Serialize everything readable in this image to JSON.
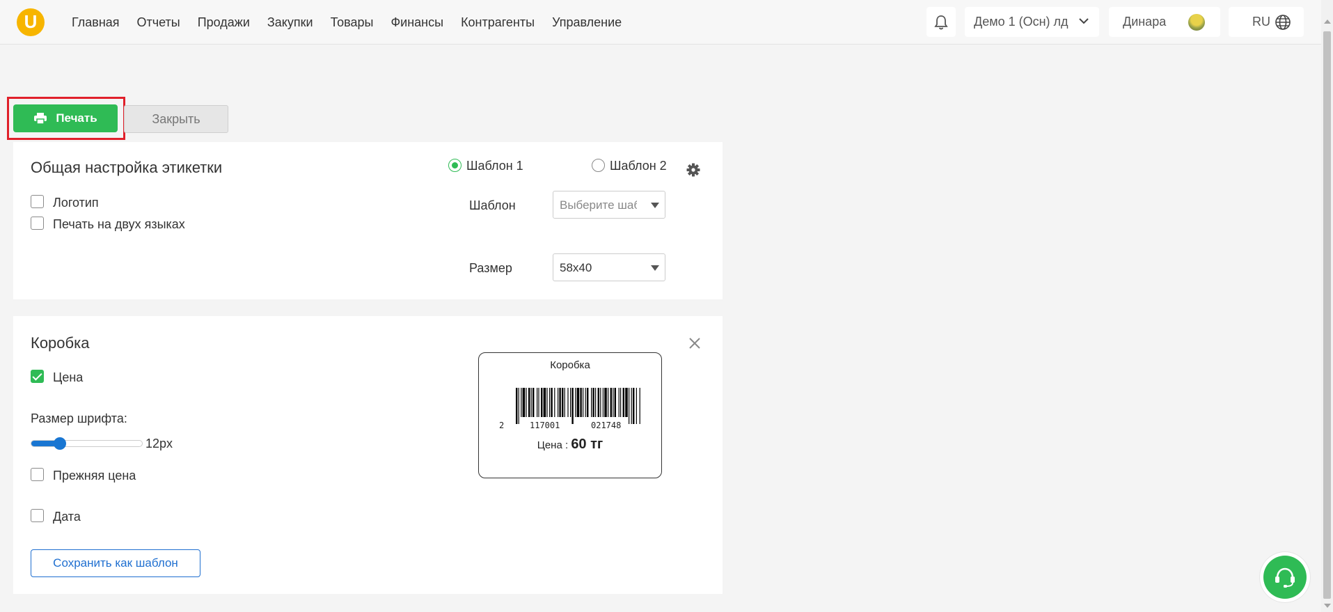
{
  "header": {
    "logo_letter": "U",
    "nav": [
      "Главная",
      "Отчеты",
      "Продажи",
      "Закупки",
      "Товары",
      "Финансы",
      "Контрагенты",
      "Управление"
    ],
    "company": "Демо 1 (Осн) лд",
    "user": "Динара",
    "language": "RU"
  },
  "actions": {
    "print_label": "Печать",
    "close_label": "Закрыть"
  },
  "general": {
    "title": "Общая настройка этикетки",
    "logo_label": "Логотип",
    "logo_checked": false,
    "bilingual_label": "Печать на двух языках",
    "bilingual_checked": false,
    "template1_label": "Шаблон 1",
    "template1_selected": true,
    "template2_label": "Шаблон 2",
    "template2_selected": false,
    "template_field_label": "Шаблон",
    "template_placeholder": "Выберите шабл",
    "size_field_label": "Размер",
    "size_value": "58x40"
  },
  "box": {
    "title": "Коробка",
    "price_label": "Цена",
    "price_checked": true,
    "font_size_label": "Размер шрифта:",
    "font_size_value": "12px",
    "old_price_label": "Прежняя цена",
    "old_price_checked": false,
    "date_label": "Дата",
    "date_checked": false,
    "save_template_label": "Сохранить как шаблон"
  },
  "preview": {
    "title": "Коробка",
    "barcode_digits": [
      "2",
      "117001",
      "021748"
    ],
    "price_prefix": "Цена :",
    "price_value": "60 тг"
  },
  "colors": {
    "accent_green": "#2fbb55",
    "highlight_red": "#e0202a",
    "link_blue": "#1f6fd0",
    "logo_yellow": "#f7b500"
  }
}
